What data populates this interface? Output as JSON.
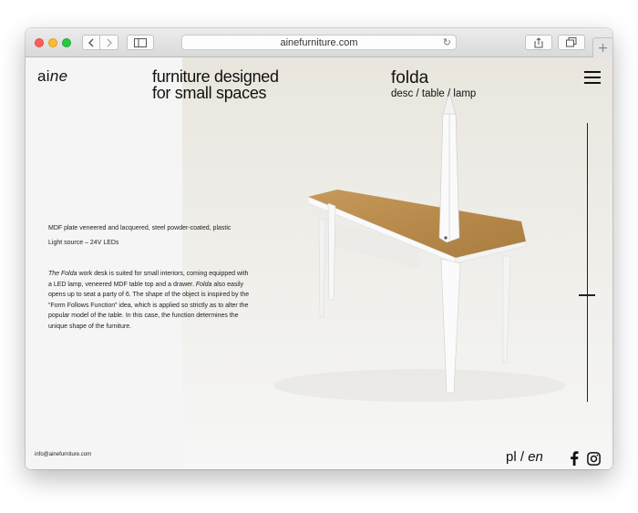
{
  "browser": {
    "url": "ainefurniture.com"
  },
  "site": {
    "logo": {
      "prefix": "ai",
      "suffix": "ne"
    },
    "tagline_line1": "furniture designed",
    "tagline_line2": "for small spaces",
    "product_name": "folda",
    "product_links": "desc / table / lamp",
    "materials": "MDF plate veneered and lacquered, steel powder-coated, plastic",
    "light_source": "Light source – 24V LEDs",
    "description": {
      "title_italic": "The Folda",
      "part1": " work desk is suited for small interiors, coming equipped with a LED lamp, veneered MDF table top and a drawer. ",
      "name_italic": "Folda",
      "part2": " also easily opens up to seat a party of 6. The shape of the object is inspired by the “Form Follows Function” idea, which is applied so strictly as to alter the popular model of the table. In this case, the function determines the unique shape of the furniture."
    },
    "email": "info@ainefurniture.com",
    "lang": {
      "pl": "pl",
      "sep": " / ",
      "en": "en"
    }
  },
  "icons": {
    "menu": "hamburger-menu-icon",
    "facebook": "facebook-icon",
    "instagram": "instagram-icon"
  }
}
